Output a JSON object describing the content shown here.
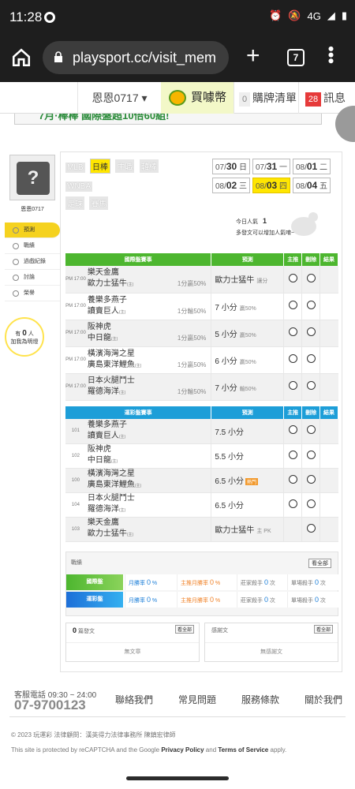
{
  "status": {
    "time": "11:28",
    "network": "4G"
  },
  "browser": {
    "url": "playsport.cc/visit_mem",
    "tab_count": "7"
  },
  "topnav": {
    "user": "恩恩0717 ▾",
    "coins": "買噱幣",
    "cart_count": "0",
    "cart_label": "購牌清單",
    "msg_count": "28",
    "msg_label": "訊息"
  },
  "banner": "7月·棒棒 國際盤超10倍60組!",
  "sidebar": {
    "username": "恩恩0717",
    "menu": [
      "預測",
      "戰績",
      "過戲紀錄",
      "討論",
      "榮譽"
    ],
    "bulb_prefix": "有",
    "bulb_count": "0",
    "bulb_suffix": "人",
    "bulb_line2": "加我為明燈"
  },
  "leagues": [
    "MLB",
    "日棒",
    "中職",
    "韓棒",
    "WNBA",
    "足球",
    "賽馬"
  ],
  "dates": [
    {
      "d": "07/",
      "n": "30",
      "w": "日"
    },
    {
      "d": "07/",
      "n": "31",
      "w": "一"
    },
    {
      "d": "08/",
      "n": "01",
      "w": "二"
    },
    {
      "d": "08/",
      "n": "02",
      "w": "三"
    },
    {
      "d": "08/",
      "n": "03",
      "w": "四"
    },
    {
      "d": "08/",
      "n": "04",
      "w": "五"
    }
  ],
  "popular": {
    "label": "今日人氣",
    "value": "1",
    "note": "多發文可以增加人氣唷~"
  },
  "intl_table": {
    "headers": [
      "國際盤賽事",
      "預測",
      "主推",
      "刪除",
      "結果"
    ],
    "rows": [
      {
        "time": "PM 17:00",
        "team1": "樂天金鷹",
        "team2": "歐力士猛牛",
        "mark": "(主)",
        "odds": "1分贏50%",
        "pred": "歐力士猛牛",
        "sub": "讓分"
      },
      {
        "time": "PM 17:00",
        "team1": "養樂多燕子",
        "team2": "讀賣巨人",
        "mark": "(主)",
        "odds": "1分輸50%",
        "pred": "7 小分",
        "sub": "贏50%"
      },
      {
        "time": "PM 17:00",
        "team1": "阪神虎",
        "team2": "中日龍",
        "mark": "(主)",
        "odds": "1分贏50%",
        "pred": "5 小分",
        "sub": "贏50%"
      },
      {
        "time": "PM 17:00",
        "team1": "橫濱海灣之星",
        "team2": "廣島東洋鯉魚",
        "mark": "(主)",
        "odds": "1分贏50%",
        "pred": "6 小分",
        "sub": "贏50%"
      },
      {
        "time": "PM 17:00",
        "team1": "日本火腿鬥士",
        "team2": "羅德海洋",
        "mark": "(主)",
        "odds": "1分輸50%",
        "pred": "7 小分",
        "sub": "輸50%"
      }
    ]
  },
  "lottery_table": {
    "headers": [
      "運彩盤賽事",
      "預測",
      "主推",
      "刪除",
      "結果"
    ],
    "rows": [
      {
        "num": "101",
        "team1": "養樂多燕子",
        "team2": "讀賣巨人",
        "mark": "(主)",
        "pred": "7.5 小分",
        "sub": "",
        "hot": ""
      },
      {
        "num": "102",
        "team1": "阪神虎",
        "team2": "中日龍",
        "mark": "(主)",
        "pred": "5.5 小分",
        "sub": "",
        "hot": ""
      },
      {
        "num": "100",
        "team1": "橫濱海灣之星",
        "team2": "廣島東洋鯉魚",
        "mark": "(主)",
        "pred": "6.5 小分",
        "sub": "",
        "hot": "熱門"
      },
      {
        "num": "104",
        "team1": "日本火腿鬥士",
        "team2": "羅德海洋",
        "mark": "(主)",
        "pred": "6.5 小分",
        "sub": "",
        "hot": ""
      },
      {
        "num": "103",
        "team1": "樂天金鷹",
        "team2": "歐力士猛牛",
        "mark": "(主)",
        "pred": "歐力士猛牛",
        "sub": "主 PK",
        "hot": ""
      }
    ]
  },
  "performance": {
    "title": "戰績",
    "more": "看全部",
    "rows": [
      {
        "tag": "國際盤",
        "c1": "月勝率",
        "v1": "0",
        "u1": "%",
        "c2": "主推月勝率",
        "v2": "0",
        "u2": "%",
        "c3": "莊家殺手",
        "v3": "0",
        "u3": "次",
        "c4": "單場殺手",
        "v4": "0",
        "u4": "次"
      },
      {
        "tag": "運彩盤",
        "c1": "月勝率",
        "v1": "0",
        "u1": "%",
        "c2": "主推月勝率",
        "v2": "0",
        "u2": "%",
        "c3": "莊家殺手",
        "v3": "0",
        "u3": "次",
        "c4": "單場殺手",
        "v4": "0",
        "u4": "次"
      }
    ]
  },
  "articles": {
    "count": "0",
    "label": "篇發文",
    "more": "看全部",
    "empty": "無文章"
  },
  "thanks": {
    "label": "感謝文",
    "more": "看全部",
    "empty": "無感謝文"
  },
  "footer": {
    "tel_label": "客服電話 09:30 ~ 24:00",
    "tel": "07-9700123",
    "links": [
      "聯絡我們",
      "常見問題",
      "服務條款",
      "關於我們"
    ],
    "copyright": "© 2023 玩運彩 法律顧問：漢英得力法律事務所 陳鎮宏律師",
    "recaptcha_pre": "This site is protected by reCAPTCHA and the Google ",
    "privacy": "Privacy Policy",
    "and": " and ",
    "terms": "Terms of Service",
    "apply": " apply."
  }
}
